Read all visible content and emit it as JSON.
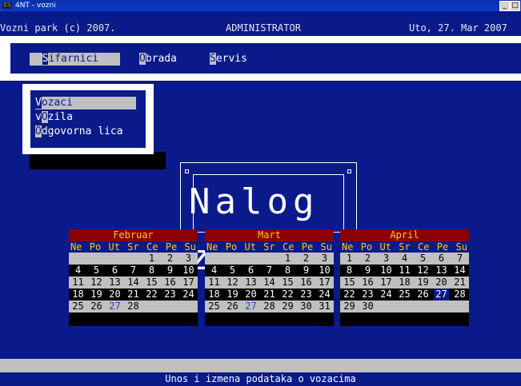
{
  "window": {
    "title": "4NT - vozni",
    "app_icon": "C:\\",
    "minimize_label": "_",
    "maximize_label": "□"
  },
  "header": {
    "left": "Vozni park (c) 2007.",
    "center": "ADMINISTRATOR",
    "right": "Uto, 27. Mar 2007"
  },
  "menu": {
    "items": [
      {
        "hot": "S",
        "rest": "ifarnici",
        "active": true
      },
      {
        "hot": "O",
        "rest": "brada",
        "active": false
      },
      {
        "hot": "S",
        "rest": "ervis",
        "active": false
      }
    ]
  },
  "dropdown": {
    "items": [
      {
        "hot": "V",
        "rest": "ozaci",
        "active": true
      },
      {
        "pre": "v",
        "hot": "O",
        "rest": "zila",
        "active": false
      },
      {
        "hot": "O",
        "rest": "dgovorna lica",
        "active": false
      }
    ]
  },
  "logo": {
    "text": "Nalog za"
  },
  "weekdays": [
    "Ne",
    "Po",
    "Ut",
    "Sr",
    "Ce",
    "Pe",
    "Su"
  ],
  "calendars": [
    {
      "month": "Februar",
      "rows": [
        [
          "",
          "",
          "",
          "",
          "1",
          "2",
          "3"
        ],
        [
          "4",
          "5",
          "6",
          "7",
          "8",
          "9",
          "10"
        ],
        [
          "11",
          "12",
          "13",
          "14",
          "15",
          "16",
          "17"
        ],
        [
          "18",
          "19",
          "20",
          "21",
          "22",
          "23",
          "24"
        ],
        [
          "25",
          "26",
          "27",
          "28",
          "",
          "",
          ""
        ]
      ],
      "today": "27"
    },
    {
      "month": "Mart",
      "rows": [
        [
          "",
          "",
          "",
          "",
          "1",
          "2",
          "3"
        ],
        [
          "4",
          "5",
          "6",
          "7",
          "8",
          "9",
          "10"
        ],
        [
          "11",
          "12",
          "13",
          "14",
          "15",
          "16",
          "17"
        ],
        [
          "18",
          "19",
          "20",
          "21",
          "22",
          "23",
          "24"
        ],
        [
          "25",
          "26",
          "27",
          "28",
          "29",
          "30",
          "31"
        ]
      ],
      "today": "27"
    },
    {
      "month": "April",
      "rows": [
        [
          "1",
          "2",
          "3",
          "4",
          "5",
          "6",
          "7"
        ],
        [
          "8",
          "9",
          "10",
          "11",
          "12",
          "13",
          "14"
        ],
        [
          "15",
          "16",
          "17",
          "18",
          "19",
          "20",
          "21"
        ],
        [
          "22",
          "23",
          "24",
          "25",
          "26",
          "27",
          "28"
        ],
        [
          "29",
          "30",
          "",
          "",
          "",
          "",
          ""
        ]
      ],
      "today": "27"
    }
  ],
  "status": {
    "bottom": "Unos i izmena podataka o vozacima"
  }
}
